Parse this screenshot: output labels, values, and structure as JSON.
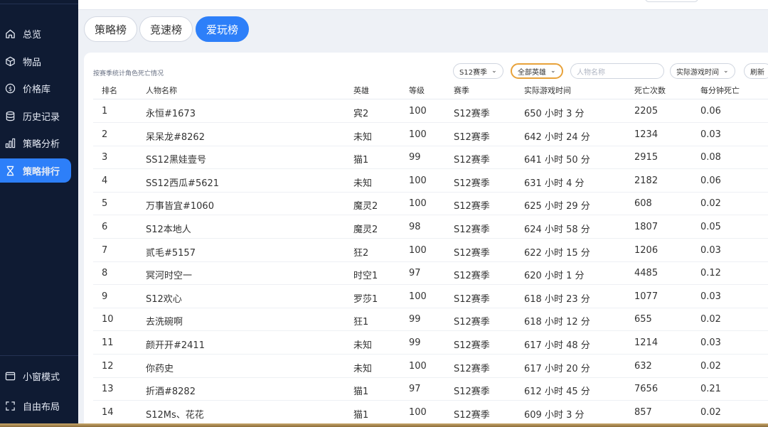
{
  "sidebar": {
    "items": [
      {
        "label": "总览",
        "icon": "home-icon"
      },
      {
        "label": "物品",
        "icon": "cube-icon"
      },
      {
        "label": "价格库",
        "icon": "dollar-icon"
      },
      {
        "label": "历史记录",
        "icon": "database-icon"
      },
      {
        "label": "策略分析",
        "icon": "bar-chart-icon"
      },
      {
        "label": "策略排行",
        "icon": "hourglass-icon",
        "active": true
      }
    ],
    "bottom_items": [
      {
        "label": "小窗模式",
        "icon": "window-icon"
      },
      {
        "label": "自由布局",
        "icon": "expand-icon"
      }
    ]
  },
  "tabs": [
    {
      "label": "策略榜",
      "active": false
    },
    {
      "label": "竞速榜",
      "active": false
    },
    {
      "label": "爱玩榜",
      "active": true
    }
  ],
  "panel": {
    "subtitle": "按赛季统计角色死亡情况",
    "filters": {
      "season": "S12赛季",
      "hero": "全部英雄",
      "name_placeholder": "人物名称",
      "sort": "实际游戏时间",
      "refresh": "刷新"
    }
  },
  "table": {
    "headers": {
      "rank": "排名",
      "name": "人物名称",
      "hero": "英雄",
      "level": "等级",
      "season": "赛季",
      "time": "实际游戏时间",
      "deaths": "死亡次数",
      "rate": "每分钟死亡"
    },
    "rows": [
      {
        "rank": "1",
        "name": "永恒#1673",
        "hero": "宾2",
        "level": "100",
        "season": "S12赛季",
        "time": "650 小时 3 分",
        "deaths": "2205",
        "rate": "0.06"
      },
      {
        "rank": "2",
        "name": "呆呆龙#8262",
        "hero": "未知",
        "level": "100",
        "season": "S12赛季",
        "time": "642 小时 24 分",
        "deaths": "1234",
        "rate": "0.03"
      },
      {
        "rank": "3",
        "name": "SS12黑娃壹号",
        "hero": "猫1",
        "level": "99",
        "season": "S12赛季",
        "time": "641 小时 50 分",
        "deaths": "2915",
        "rate": "0.08"
      },
      {
        "rank": "4",
        "name": "SS12西瓜#5621",
        "hero": "未知",
        "level": "100",
        "season": "S12赛季",
        "time": "631 小时 4 分",
        "deaths": "2182",
        "rate": "0.06"
      },
      {
        "rank": "5",
        "name": "万事皆宜#1060",
        "hero": "魔灵2",
        "level": "100",
        "season": "S12赛季",
        "time": "625 小时 29 分",
        "deaths": "608",
        "rate": "0.02"
      },
      {
        "rank": "6",
        "name": "S12本地人",
        "hero": "魔灵2",
        "level": "98",
        "season": "S12赛季",
        "time": "624 小时 58 分",
        "deaths": "1807",
        "rate": "0.05"
      },
      {
        "rank": "7",
        "name": "贰毛#5157",
        "hero": "狂2",
        "level": "100",
        "season": "S12赛季",
        "time": "622 小时 15 分",
        "deaths": "1206",
        "rate": "0.03"
      },
      {
        "rank": "8",
        "name": "冥河时空一",
        "hero": "时空1",
        "level": "97",
        "season": "S12赛季",
        "time": "620 小时 1 分",
        "deaths": "4485",
        "rate": "0.12"
      },
      {
        "rank": "9",
        "name": "S12欢心",
        "hero": "罗莎1",
        "level": "100",
        "season": "S12赛季",
        "time": "618 小时 23 分",
        "deaths": "1077",
        "rate": "0.03"
      },
      {
        "rank": "10",
        "name": "去洗碗啊",
        "hero": "狂1",
        "level": "99",
        "season": "S12赛季",
        "time": "618 小时 12 分",
        "deaths": "655",
        "rate": "0.02"
      },
      {
        "rank": "11",
        "name": "颜开开#2411",
        "hero": "未知",
        "level": "99",
        "season": "S12赛季",
        "time": "617 小时 48 分",
        "deaths": "1214",
        "rate": "0.03"
      },
      {
        "rank": "12",
        "name": "你药史",
        "hero": "未知",
        "level": "100",
        "season": "S12赛季",
        "time": "617 小时 20 分",
        "deaths": "632",
        "rate": "0.02"
      },
      {
        "rank": "13",
        "name": "折酒#8282",
        "hero": "猫1",
        "level": "97",
        "season": "S12赛季",
        "time": "612 小时 45 分",
        "deaths": "7656",
        "rate": "0.21"
      },
      {
        "rank": "14",
        "name": "S12Ms、花花",
        "hero": "猫1",
        "level": "100",
        "season": "S12赛季",
        "time": "609 小时 3 分",
        "deaths": "857",
        "rate": "0.02"
      }
    ]
  }
}
